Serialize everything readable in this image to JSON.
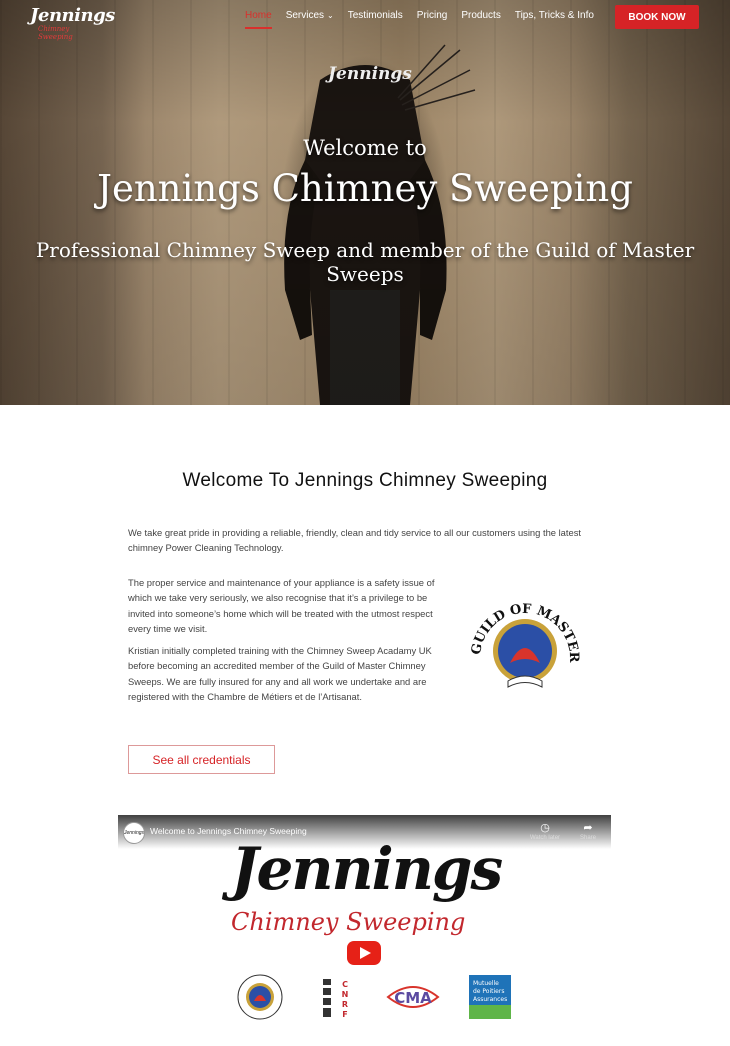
{
  "nav": {
    "logo_text": "Jennings",
    "logo_sub": "Chimney Sweeping",
    "items": [
      {
        "label": "Home",
        "active": true
      },
      {
        "label": "Services",
        "dropdown": true
      },
      {
        "label": "Testimonials"
      },
      {
        "label": "Pricing"
      },
      {
        "label": "Products"
      },
      {
        "label": "Tips, Tricks & Info"
      }
    ],
    "book_label": "BOOK NOW"
  },
  "hero": {
    "welcome": "Welcome to",
    "title": "Jennings Chimney Sweeping",
    "subtitle": "Professional Chimney Sweep and member of the Guild of Master Sweeps"
  },
  "main": {
    "heading": "Welcome To Jennings Chimney Sweeping",
    "para1": "We take great pride in providing a reliable, friendly, clean and tidy service to all our customers using the latest chimney Power Cleaning Technology.",
    "para2": "The proper service and maintenance of your appliance is a safety issue of which we take very seriously, we also recognise that it’s a privilege to be invited into someone’s home which will be treated with the utmost respect every time we visit.",
    "para3": "Kristian initially completed training with the Chimney Sweep Acadamy UK before becoming an accredited member of the Guild of Master Chimney Sweeps. We are fully insured for any and all work we undertake and are registered with the Chambre de Métiers et de l’Artisanat.",
    "seal_text": "GUILD OF MASTER SWEEPS",
    "credentials_button": "See all credentials"
  },
  "video": {
    "title": "Welcome to Jennings Chimney Sweeping",
    "channel_thumb": "Jennings",
    "watch_later": "Watch later",
    "share": "Share",
    "logo_main": "Jennings",
    "logo_sub": "Chimney Sweeping",
    "badges": [
      "GUILD OF MASTER SWEEPS",
      "CNRF",
      "CMA",
      "Mutuelle de Poitiers Assurances"
    ]
  },
  "colors": {
    "accent": "#d62326",
    "heading": "#111111",
    "text": "#444444"
  }
}
